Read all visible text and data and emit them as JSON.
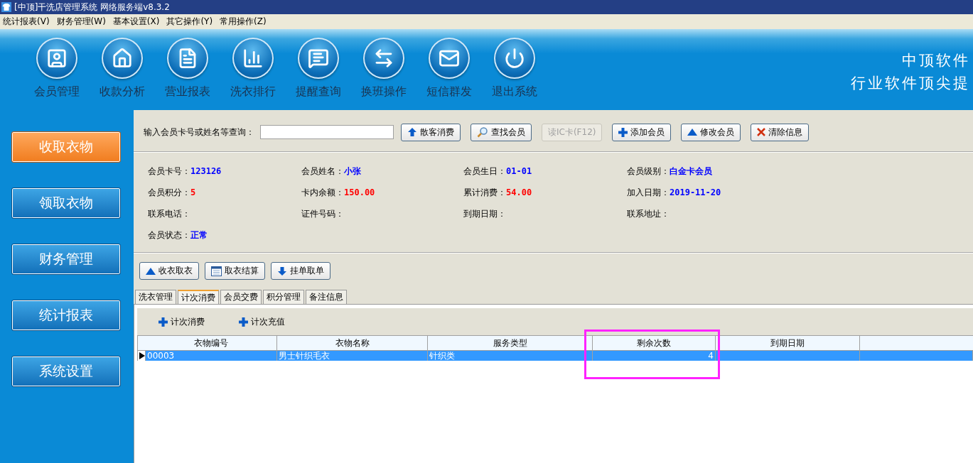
{
  "window": {
    "title": "[中顶]干洗店管理系统 网络服务端v8.3.2"
  },
  "menu": [
    "统计报表(V)",
    "财务管理(W)",
    "基本设置(X)",
    "其它操作(Y)",
    "常用操作(Z)"
  ],
  "banner": {
    "tools": [
      {
        "label": "会员管理",
        "kind": "member"
      },
      {
        "label": "收款分析",
        "kind": "house"
      },
      {
        "label": "营业报表",
        "kind": "document"
      },
      {
        "label": "洗衣排行",
        "kind": "chart"
      },
      {
        "label": "提醒查询",
        "kind": "message"
      },
      {
        "label": "换班操作",
        "kind": "swap"
      },
      {
        "label": "短信群发",
        "kind": "mail"
      },
      {
        "label": "退出系统",
        "kind": "power"
      }
    ],
    "brand": [
      "中顶软件",
      "行业软件顶尖提"
    ]
  },
  "sidebar": [
    {
      "label": "收取衣物",
      "selected": true
    },
    {
      "label": "领取衣物",
      "selected": false
    },
    {
      "label": "财务管理",
      "selected": false
    },
    {
      "label": "统计报表",
      "selected": false
    },
    {
      "label": "系统设置",
      "selected": false
    }
  ],
  "search": {
    "label": "输入会员卡号或姓名等查询："
  },
  "search_buttons": [
    {
      "label": "散客消费",
      "kind": "up-arrow",
      "disabled": false
    },
    {
      "label": "查找会员",
      "kind": "magnifier",
      "disabled": false
    },
    {
      "label": "读IC卡(F12)",
      "kind": "plain",
      "disabled": true
    },
    {
      "label": "添加会员",
      "kind": "plus",
      "disabled": false
    },
    {
      "label": "修改会员",
      "kind": "triangle",
      "disabled": false
    },
    {
      "label": "清除信息",
      "kind": "cross",
      "disabled": false
    }
  ],
  "member_fields": [
    {
      "label": "会员卡号：",
      "value": "123126",
      "color": "#0000ff"
    },
    {
      "label": "会员姓名：",
      "value": "小张",
      "color": "#0000ff"
    },
    {
      "label": "会员生日：",
      "value": "01-01",
      "color": "#0000ff"
    },
    {
      "label": "会员级别：",
      "value": "白金卡会员",
      "color": "#0000ff"
    },
    {
      "label": "会员积分：",
      "value": "5",
      "color": "#ff0000"
    },
    {
      "label": "卡内余额：",
      "value": "150.00",
      "color": "#ff0000"
    },
    {
      "label": "累计消费：",
      "value": "54.00",
      "color": "#ff0000"
    },
    {
      "label": "加入日期：",
      "value": "2019-11-20",
      "color": "#0000ff"
    },
    {
      "label": "联系电话："
    },
    {
      "label": "证件号码："
    },
    {
      "label": "到期日期："
    },
    {
      "label": "联系地址："
    },
    {
      "label": "会员状态：",
      "value": "正常",
      "color": "#0000ff"
    }
  ],
  "action_buttons": [
    {
      "label": "收衣取衣",
      "kind": "triangle"
    },
    {
      "label": "取衣结算",
      "kind": "calendar"
    },
    {
      "label": "挂单取单",
      "kind": "down-arrow"
    }
  ],
  "tabs": [
    {
      "label": "洗衣管理",
      "selected": false
    },
    {
      "label": "计次消费",
      "selected": true
    },
    {
      "label": "会员交费",
      "selected": false
    },
    {
      "label": "积分管理",
      "selected": false
    },
    {
      "label": "备注信息",
      "selected": false
    }
  ],
  "panel_actions": [
    "计次消费",
    "计次充值"
  ],
  "table": {
    "columns": [
      {
        "label": "衣物编号",
        "kind": "text",
        "highlighted": false
      },
      {
        "label": "衣物名称",
        "kind": "text",
        "highlighted": false
      },
      {
        "label": "服务类型",
        "kind": "text",
        "highlighted": false
      },
      {
        "label": "剩余次数",
        "kind": "number",
        "highlighted": true
      },
      {
        "label": "到期日期",
        "kind": "text",
        "highlighted": false
      }
    ],
    "rows": [
      {
        "selected": true,
        "cells": [
          "00003",
          "男士针织毛衣",
          "针织类",
          "4"
        ]
      }
    ]
  }
}
